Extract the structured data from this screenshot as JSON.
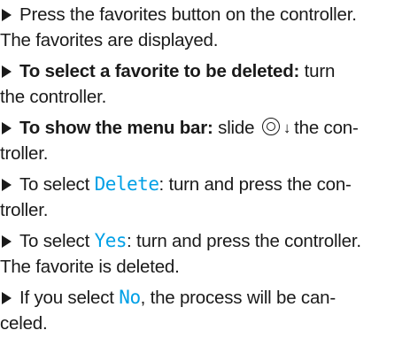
{
  "steps": [
    {
      "line1": "Press the favorites button on the controller.",
      "line2": "The favorites are displayed."
    },
    {
      "bold": "To select a favorite to be deleted:",
      "rest": " turn",
      "line2": "the controller."
    },
    {
      "bold": "To show the menu bar:",
      "pre_icon": " slide ",
      "icon": "controller-slide-down-icon",
      "slide_glyph": "↓",
      "post_icon": "the con-",
      "line2": "troller."
    },
    {
      "pre": "To select ",
      "ui": "Delete",
      "post": ": turn and press the con-",
      "line2": "troller."
    },
    {
      "pre": "To select ",
      "ui": "Yes",
      "post": ": turn and press the controller.",
      "line2": "The favorite is deleted."
    },
    {
      "pre": "If you select ",
      "ui": "No",
      "post": ", the process will be can-",
      "line2": "celed."
    }
  ],
  "colors": {
    "ui_text": "#00a0e6",
    "body_text": "#1a1a1a"
  }
}
